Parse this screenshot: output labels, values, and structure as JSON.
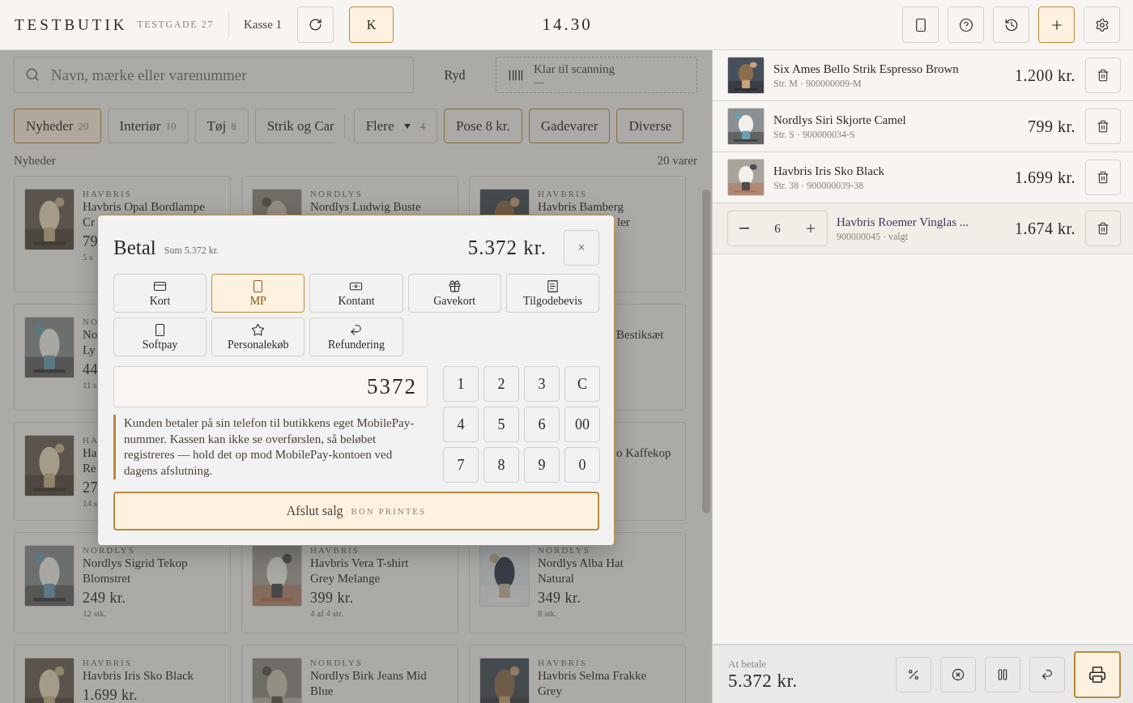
{
  "header": {
    "brand": "TESTBUTIK",
    "address": "TESTGADE 27",
    "register": "Kasse 1",
    "user": {
      "initial": "K",
      "selected": true
    },
    "clock": "14.30"
  },
  "tools": [
    {
      "kind": "phone",
      "selected": false
    },
    {
      "kind": "help",
      "selected": false
    },
    {
      "kind": "history",
      "selected": false
    },
    {
      "kind": "add",
      "selected": true
    },
    {
      "kind": "settings",
      "selected": false
    }
  ],
  "search": {
    "placeholder": "Navn, mærke eller varenummer"
  },
  "clear": "Ryd",
  "scanner": {
    "status": "Klar til scanning",
    "value": "—"
  },
  "categories": [
    {
      "kind": "category",
      "label": "Nyheder",
      "count": "20",
      "selected": true
    },
    {
      "kind": "category",
      "label": "Interiør",
      "count": "10",
      "selected": false
    },
    {
      "kind": "category",
      "label": "Tøj",
      "count": "8",
      "selected": false
    },
    {
      "kind": "clipped",
      "label": "Strik og Car",
      "selected": false
    },
    {
      "kind": "more",
      "label": "Flere",
      "count": "4",
      "selected": false
    },
    {
      "kind": "quick",
      "label": "Pose 8 kr."
    },
    {
      "kind": "quick",
      "label": "Gadevarer"
    },
    {
      "kind": "quick",
      "label": "Diverse"
    }
  ],
  "section": {
    "title": "Nyheder",
    "count": "20 varer"
  },
  "products": [
    {
      "kind": "product",
      "brand": "HAVBRIS",
      "name": [
        "Havbris Opal Bordlampe",
        "Cr"
      ],
      "price": "79",
      "stock": "5 s"
    },
    {
      "kind": "product",
      "brand": "NORDLYS",
      "name": [
        "Nordlys Ludwig Buste"
      ]
    },
    {
      "kind": "product",
      "brand": "HAVBRIS",
      "name": [
        "Havbris Bamberg"
      ],
      "visible_tail": "ler"
    },
    {
      "kind": "left_edge",
      "brand": "NO",
      "name": [
        "No",
        "Ly"
      ],
      "price": "44",
      "stock": "11 s"
    },
    {
      "kind": "covered"
    },
    {
      "kind": "right_edge",
      "visible_tail": "Bestiksæt"
    },
    {
      "kind": "left_edge",
      "brand": "HA",
      "name": [
        "Ha",
        "Re"
      ],
      "price": "27",
      "stock": "14 s"
    },
    {
      "kind": "covered"
    },
    {
      "kind": "right_edge",
      "visible_tail": "o Kaffekop"
    },
    {
      "kind": "product",
      "brand": "NORDLYS",
      "name": [
        "Nordlys Sigrid Tekop",
        "Blomstret"
      ],
      "price": "249 kr.",
      "stock": "12 stk."
    },
    {
      "kind": "product",
      "brand": "HAVBRIS",
      "name": [
        "Havbris Vera T-shirt",
        "Grey Melange"
      ],
      "price": "399 kr.",
      "stock": "4 af 4 str."
    },
    {
      "kind": "product",
      "brand": "NORDLYS",
      "name": [
        "Nordlys Alba Hat",
        "Natural"
      ],
      "price": "349 kr.",
      "stock": "8 stk."
    },
    {
      "kind": "product",
      "brand": "HAVBRIS",
      "name": [
        "Havbris Iris Sko Black"
      ],
      "price": "1.699 kr."
    },
    {
      "kind": "product",
      "brand": "NORDLYS",
      "name": [
        "Nordlys Birk Jeans Mid",
        "Blue"
      ]
    },
    {
      "kind": "product",
      "brand": "HAVBRIS",
      "name": [
        "Havbris Selma Frakke",
        "Grey"
      ]
    }
  ],
  "cart": [
    {
      "kind": "item",
      "name": "Six Ames Bello Strik Espresso Brown",
      "meta": "Str. M · 900000009-M",
      "price": "1.200 kr.",
      "selected": false
    },
    {
      "kind": "item",
      "name": "Nordlys Siri Skjorte Camel",
      "meta": "Str. S · 900000034-S",
      "price": "799 kr.",
      "selected": false
    },
    {
      "kind": "item",
      "name": "Havbris Iris Sko Black",
      "meta": "Str. 38 · 900000039-38",
      "price": "1.699 kr.",
      "selected": false
    },
    {
      "kind": "quantity",
      "quantity": "6",
      "name": "Havbris Roemer Vinglas ...",
      "meta": "900000045 · valgt",
      "price": "1.674 kr.",
      "selected": true
    }
  ],
  "footer": {
    "label": "At betale",
    "amount": "5.372 kr.",
    "actions": [
      {
        "kind": "discount",
        "selected": false
      },
      {
        "kind": "cancel",
        "selected": false
      },
      {
        "kind": "park",
        "selected": false
      },
      {
        "kind": "return",
        "selected": false
      },
      {
        "kind": "checkout",
        "selected": true
      }
    ]
  },
  "dialog": {
    "title": "Betal",
    "subtitle": "Sum 5.372 kr.",
    "total": "5.372 kr.",
    "close": "×",
    "methods": [
      {
        "kind": "card",
        "label": "Kort",
        "selected": false
      },
      {
        "kind": "mobile",
        "label": "MP",
        "selected": true
      },
      {
        "kind": "cash",
        "label": "Kontant",
        "selected": false
      },
      {
        "kind": "gift",
        "label": "Gavekort",
        "selected": false
      },
      {
        "kind": "voucher",
        "label": "Tilgodebevis",
        "selected": false
      },
      {
        "kind": "mobile",
        "label": "Softpay",
        "selected": false
      },
      {
        "kind": "staff",
        "label": "Personalekøb",
        "selected": false
      },
      {
        "kind": "refund",
        "label": "Refundering",
        "selected": false
      }
    ],
    "amount": "5372",
    "note": "Kunden betaler på sin telefon til butikkens eget MobilePay-nummer. Kassen kan ikke se overførslen, så beløbet registreres — hold det op mod MobilePay-kontoen ved dagens afslutning.",
    "keys": [
      "1",
      "2",
      "3",
      "C",
      "4",
      "5",
      "6",
      "00",
      "7",
      "8",
      "9",
      "0"
    ],
    "finish": {
      "label": "Afslut salg",
      "note": "BON PRINTES"
    }
  }
}
